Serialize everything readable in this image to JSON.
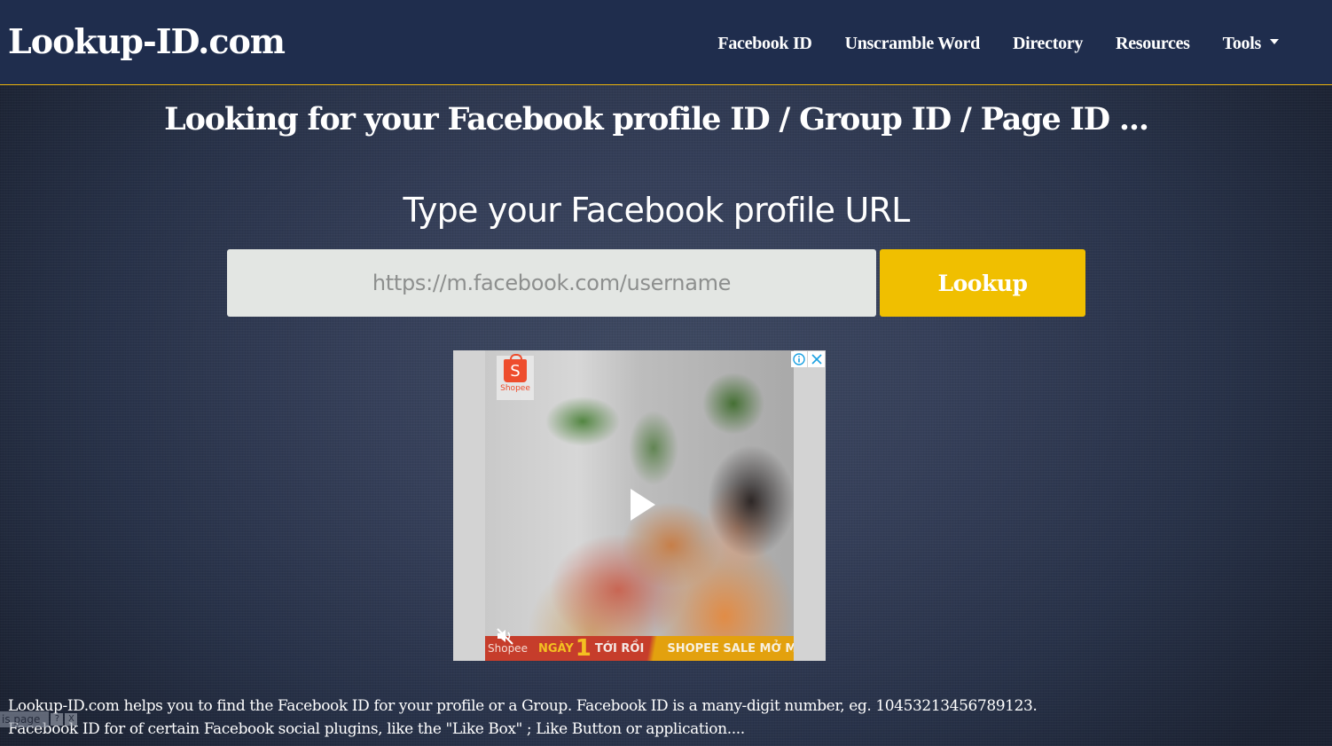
{
  "header": {
    "brand": "Lookup-ID.com",
    "nav": [
      {
        "label": "Facebook ID"
      },
      {
        "label": "Unscramble Word"
      },
      {
        "label": "Directory"
      },
      {
        "label": "Resources"
      },
      {
        "label": "Tools",
        "icon": "caret-down-icon"
      }
    ]
  },
  "main": {
    "headline": "Looking for your Facebook profile ID / Group ID / Page ID ...",
    "subtitle": "Type your Facebook profile URL",
    "search": {
      "value": "",
      "placeholder": "https://m.facebook.com/username",
      "button_label": "Lookup"
    }
  },
  "ad": {
    "logo_letter": "S",
    "logo_text": "Shopee",
    "banner": {
      "brand": "Shopee",
      "ngay": "NGÀY",
      "number": "1",
      "toi_roi": "TỚI RỒI",
      "sale": "SHOPEE SALE MỞ M"
    },
    "info_icon": "info-icon",
    "close_icon": "close-icon",
    "play_icon": "play-icon",
    "mute_icon": "muted-speaker-icon"
  },
  "description": {
    "line1": "Lookup-ID.com helps you to find the Facebook ID for your profile or a Group. Facebook ID is a many-digit number, eg. 10453213456789123.",
    "line2": "Facebook ID for of certain Facebook social plugins, like the \"Like Box\" ; Like Button or application...."
  },
  "feedback_widget": {
    "label": "is page",
    "help": "?",
    "close": "X"
  },
  "colors": {
    "header_bg": "#1f2d4d",
    "header_border": "#e7b10a",
    "button_bg": "#f0bf00",
    "input_bg": "#e3e6e3",
    "shopee_orange": "#ee4d2d",
    "ad_icon_blue": "#1ba1e2"
  }
}
